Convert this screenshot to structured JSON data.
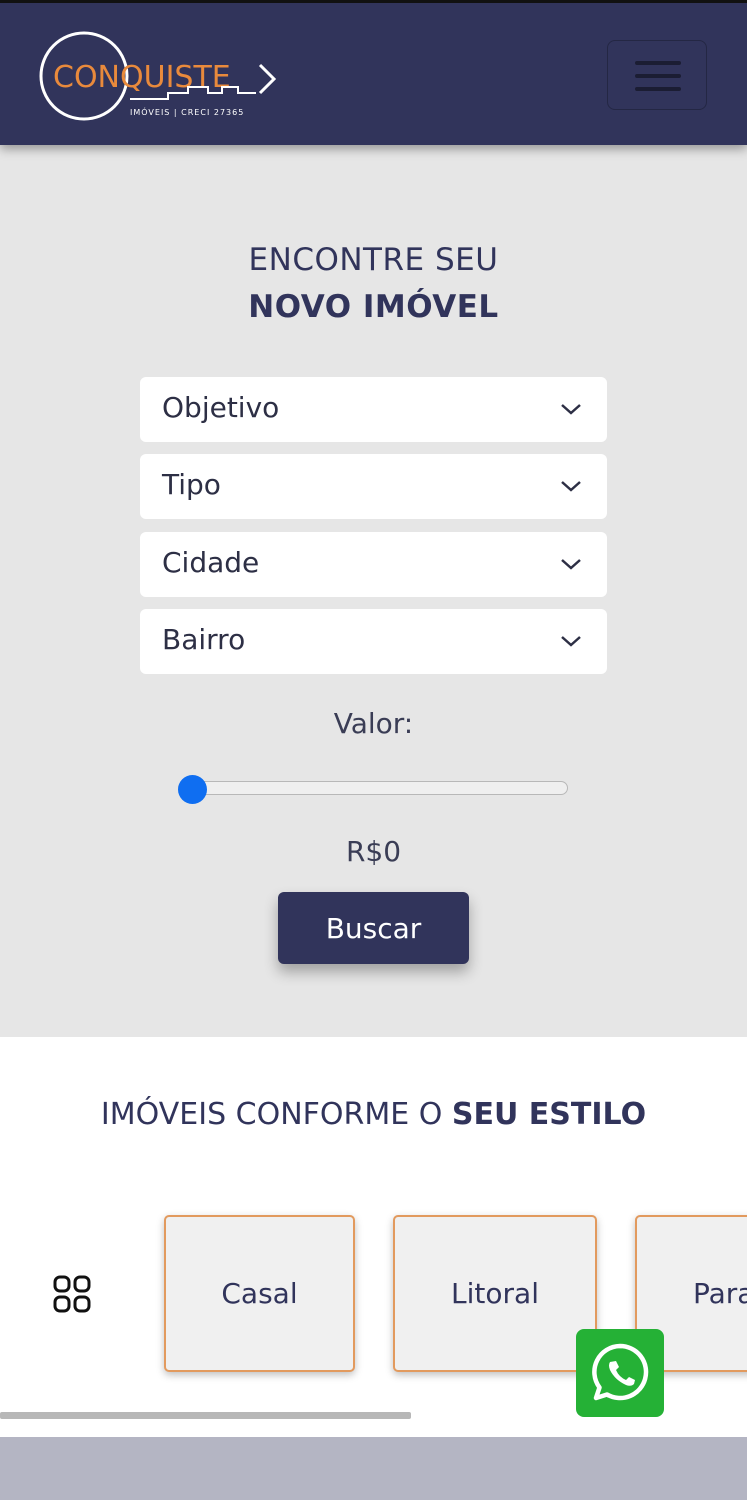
{
  "header": {
    "logo_name": "CONQUISTE",
    "logo_subtitle": "IMÓVEIS | CRECI 27365",
    "menu_icon": "hamburger-icon"
  },
  "search": {
    "title_line1": "ENCONTRE SEU",
    "title_line2": "NOVO IMÓVEL",
    "selects": [
      {
        "label": "Objetivo"
      },
      {
        "label": "Tipo"
      },
      {
        "label": "Cidade"
      },
      {
        "label": "Bairro"
      }
    ],
    "valor_label": "Valor:",
    "valor_value": "R$0",
    "slider_fraction": 0,
    "button_label": "Buscar"
  },
  "estilo": {
    "title_regular": "IMÓVEIS CONFORME O ",
    "title_bold": "SEU ESTILO",
    "cards": [
      {
        "label": "Casal"
      },
      {
        "label": "Litoral"
      },
      {
        "label": "Para"
      }
    ]
  },
  "colors": {
    "primary": "#31345b",
    "accent": "#e29a5e",
    "slider": "#0f6ef1",
    "whatsapp": "#25b136"
  }
}
